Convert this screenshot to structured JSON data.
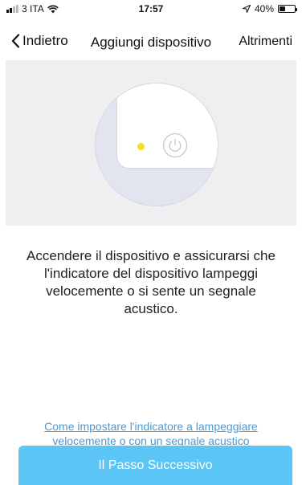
{
  "status_bar": {
    "carrier": "3 ITA",
    "time": "17:57",
    "battery": "40%",
    "battery_level": 0.4
  },
  "nav": {
    "back_label": "Indietro",
    "title": "Aggiungi dispositivo",
    "right_label": "Altrimenti"
  },
  "illustration": {
    "led_color": "#f6df1c",
    "icons": [
      "power-icon"
    ]
  },
  "instruction": "Accendere il dispositivo e assicurarsi che l'indicatore del dispositivo lampeggi velocemente o si sente un segnale acustico.",
  "help_link": "Come impostare l'indicatore a lampeggiare velocemente o con un segnale acustico",
  "next_button": "Il Passo Successivo",
  "colors": {
    "accent": "#5bc6f5",
    "link": "#4a9ad6"
  }
}
